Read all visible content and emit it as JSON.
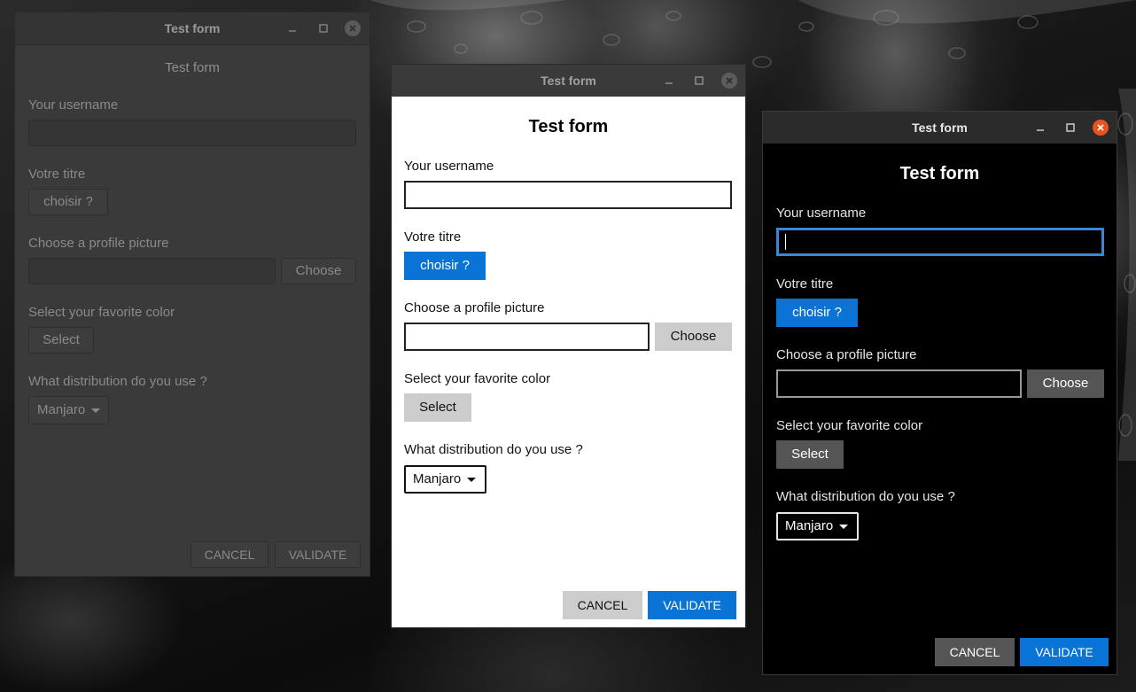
{
  "windows": [
    {
      "title": "Test form",
      "heading": "Test form",
      "username_label": "Your username",
      "username_value": "",
      "title_label": "Votre titre",
      "title_button": "choisir ?",
      "picture_label": "Choose a profile picture",
      "picture_value": "",
      "choose_button": "Choose",
      "color_label": "Select your favorite color",
      "select_button": "Select",
      "distro_label": "What distribution do you use ?",
      "distro_value": "Manjaro",
      "cancel_button": "CANCEL",
      "validate_button": "VALIDATE"
    },
    {
      "title": "Test form",
      "heading": "Test form",
      "username_label": "Your username",
      "username_value": "",
      "title_label": "Votre titre",
      "title_button": "choisir ?",
      "picture_label": "Choose a profile picture",
      "picture_value": "",
      "choose_button": "Choose",
      "color_label": "Select your favorite color",
      "select_button": "Select",
      "distro_label": "What distribution do you use ?",
      "distro_value": "Manjaro",
      "cancel_button": "CANCEL",
      "validate_button": "VALIDATE"
    },
    {
      "title": "Test form",
      "heading": "Test form",
      "username_label": "Your username",
      "username_value": "",
      "title_label": "Votre titre",
      "title_button": "choisir ?",
      "picture_label": "Choose a profile picture",
      "picture_value": "",
      "choose_button": "Choose",
      "color_label": "Select your favorite color",
      "select_button": "Select",
      "distro_label": "What distribution do you use ?",
      "distro_value": "Manjaro",
      "cancel_button": "CANCEL",
      "validate_button": "VALIDATE"
    }
  ],
  "colors": {
    "accent_blue": "#0a74d6",
    "close_orange": "#e95420",
    "focus_blue": "#3a86d6"
  },
  "icons": {
    "minimize": "minimize-icon",
    "maximize": "maximize-icon",
    "close": "close-icon",
    "dropdown": "dropdown-caret-icon"
  }
}
